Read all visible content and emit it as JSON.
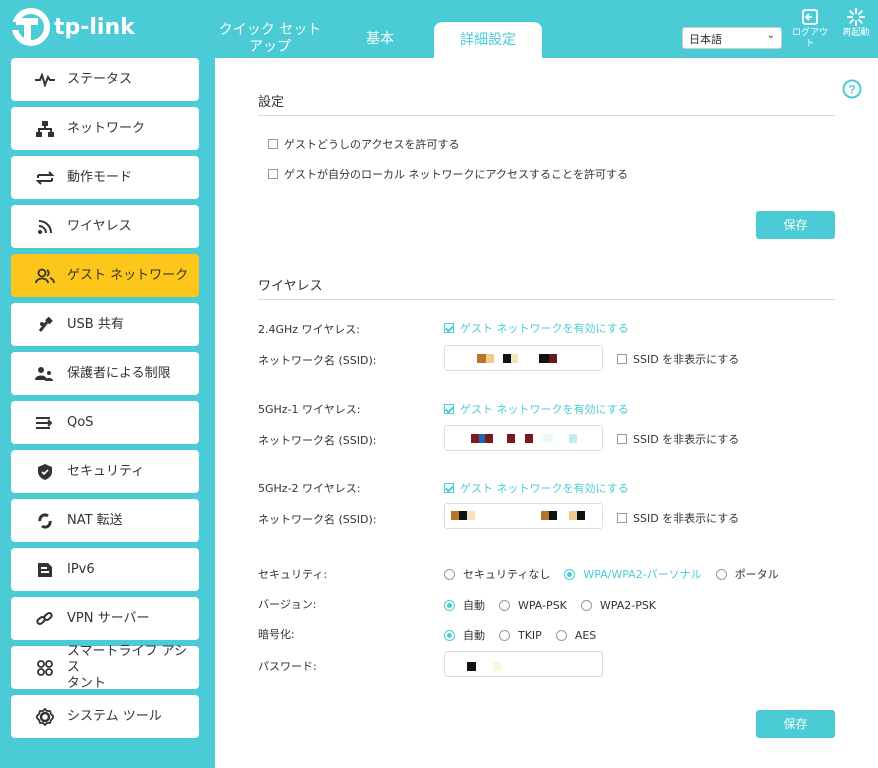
{
  "header": {
    "logo_text": "tp-link",
    "tabs": [
      {
        "label": "クイック セット"
      },
      {
        "label": "アップ"
      },
      {
        "label": "基本"
      },
      {
        "label": "詳細設定"
      }
    ],
    "language": "日本語",
    "logout_label_1": "ログアウ",
    "logout_label_2": "ト",
    "reboot_label": "再起動"
  },
  "sidebar": {
    "items": [
      {
        "label": "ステータス",
        "icon": "pulse-icon"
      },
      {
        "label": "ネットワーク",
        "icon": "network-icon"
      },
      {
        "label": "動作モード",
        "icon": "mode-icon"
      },
      {
        "label": "ワイヤレス",
        "icon": "wireless-icon"
      },
      {
        "label": "ゲスト ネットワーク",
        "icon": "guest-icon",
        "active": true
      },
      {
        "label": "USB 共有",
        "icon": "usb-icon"
      },
      {
        "label": "保護者による制限",
        "icon": "parental-icon"
      },
      {
        "label": "QoS",
        "icon": "qos-icon"
      },
      {
        "label": "セキュリティ",
        "icon": "shield-icon"
      },
      {
        "label": "NAT 転送",
        "icon": "nat-icon"
      },
      {
        "label": "IPv6",
        "icon": "ipv6-icon"
      },
      {
        "label": "VPN サーバー",
        "icon": "vpn-icon"
      },
      {
        "label": "スマートライフ アシス",
        "label2": "タント",
        "icon": "smartlife-icon"
      },
      {
        "label": "システム ツール",
        "icon": "gear-icon"
      }
    ]
  },
  "settings": {
    "title": "設定",
    "allow_guests": "ゲストどうしのアクセスを許可する",
    "allow_local": "ゲストが自分のローカル ネットワークにアクセスすることを許可する",
    "save": "保存"
  },
  "wireless": {
    "title": "ワイヤレス",
    "band24_label": "2.4GHz ワイヤレス:",
    "band5_1_label": "5GHz-1 ワイヤレス:",
    "band5_2_label": "5GHz-2 ワイヤレス:",
    "enable_label": "ゲスト ネットワークを有効にする",
    "ssid_label": "ネットワーク名 (SSID):",
    "hide_ssid": "SSID を非表示にする",
    "security_label": "セキュリティ:",
    "security_opts": [
      "セキュリティなし",
      "WPA/WPA2-パーソナル",
      "ポータル"
    ],
    "version_label": "バージョン:",
    "version_opts": [
      "自動",
      "WPA-PSK",
      "WPA2-PSK"
    ],
    "encryption_label": "暗号化:",
    "encryption_opts": [
      "自動",
      "TKIP",
      "AES"
    ],
    "password_label": "パスワード:",
    "save": "保存"
  },
  "colors": {
    "accent": "#4acbd6",
    "active": "#fdc61a"
  }
}
